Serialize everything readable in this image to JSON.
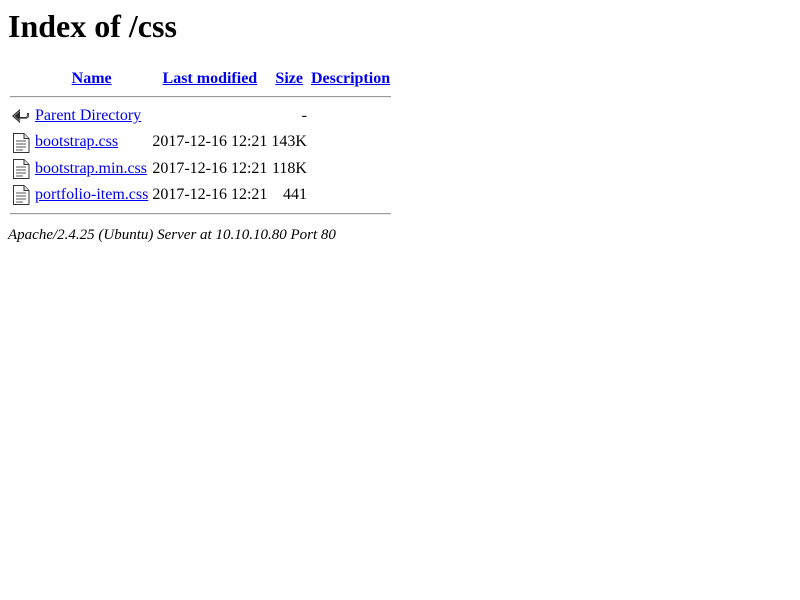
{
  "page": {
    "title": "Index of /css"
  },
  "columns": {
    "name": "Name",
    "last_modified": "Last modified",
    "size": "Size",
    "description": "Description"
  },
  "rows": [
    {
      "icon": "back-icon",
      "name": "Parent Directory",
      "modified": "",
      "size": "-",
      "description": ""
    },
    {
      "icon": "text-file-icon",
      "name": "bootstrap.css",
      "modified": "2017-12-16 12:21",
      "size": "143K",
      "description": ""
    },
    {
      "icon": "text-file-icon",
      "name": "bootstrap.min.css",
      "modified": "2017-12-16 12:21",
      "size": "118K",
      "description": ""
    },
    {
      "icon": "text-file-icon",
      "name": "portfolio-item.css",
      "modified": "2017-12-16 12:21",
      "size": "441",
      "description": ""
    }
  ],
  "icon_alts": {
    "parent": "[PARENTDIR]",
    "text": "[TXT]"
  },
  "footer": {
    "server_signature": "Apache/2.4.25 (Ubuntu) Server at 10.10.10.80 Port 80"
  },
  "colors": {
    "link": "#0000ee",
    "text": "#000000",
    "background": "#ffffff"
  }
}
